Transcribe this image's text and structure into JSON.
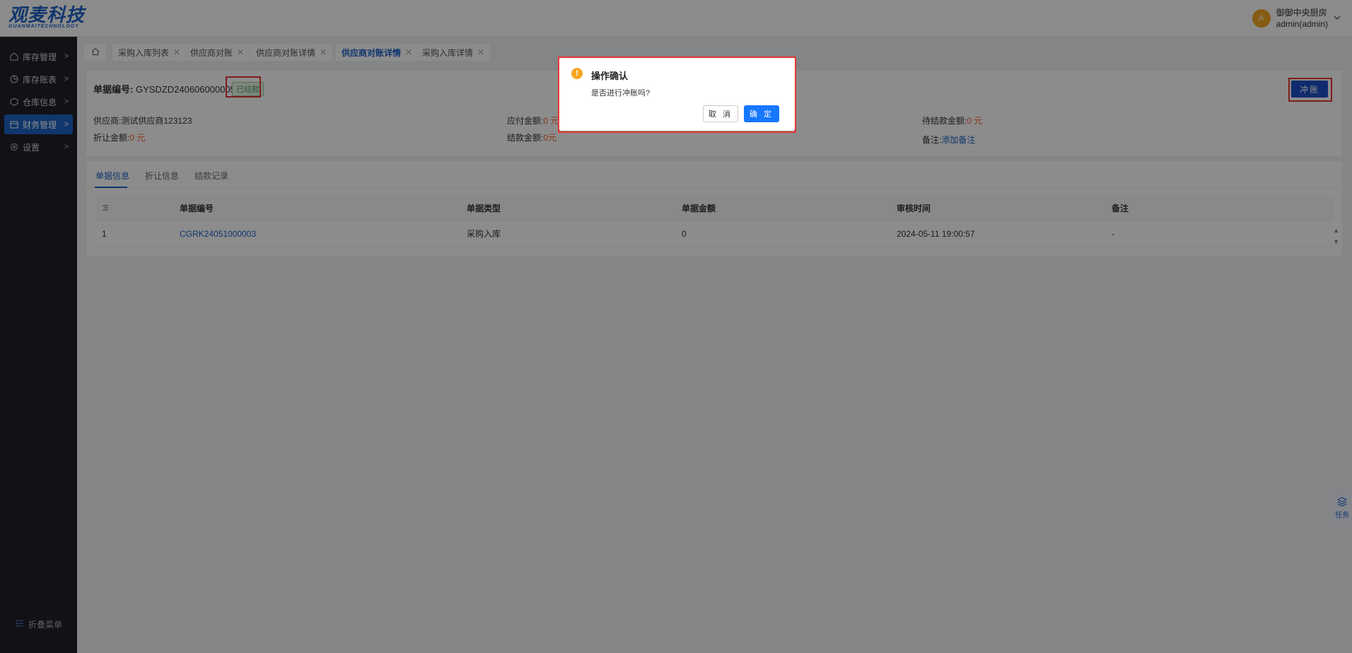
{
  "brand": {
    "name": "观麦科技",
    "sub": "GUANMAITECHNOLOGY",
    "color": "#1e63c7"
  },
  "user": {
    "avatar_letter": "A",
    "name": "御御中央厨房",
    "account": "admin(admin)"
  },
  "sidebar": {
    "items": [
      {
        "label": "库存管理",
        "icon": "warehouse-icon"
      },
      {
        "label": "库存账表",
        "icon": "chart-icon"
      },
      {
        "label": "仓库信息",
        "icon": "box-icon"
      },
      {
        "label": "财务管理",
        "icon": "finance-icon",
        "active": true
      },
      {
        "label": "设置",
        "icon": "gear-icon"
      }
    ],
    "collapse_label": "折叠菜单"
  },
  "tabs": [
    {
      "label": "采购入库列表"
    },
    {
      "label": "供应商对账"
    },
    {
      "label": "供应商对账详情"
    },
    {
      "label": "供应商对账详情",
      "active": true
    },
    {
      "label": "采购入库详情"
    }
  ],
  "summary": {
    "doc_label": "单据编号:",
    "doc_no": "GYSDZD240606000005",
    "status": "已结款",
    "reverse_button": "冲账",
    "supplier_label": "供应商:",
    "supplier": "测试供应商123123",
    "discount_label": "折让金额:",
    "discount": "0 元",
    "payable_label": "应付金额:",
    "payable": "0 元",
    "settled_label": "结款金额:",
    "settled": "0元",
    "pending_label": "待结款金额:",
    "pending": "0 元",
    "remark_label": "备注:",
    "remark_link": "添加备注"
  },
  "detail": {
    "subtabs": [
      "单据信息",
      "折让信息",
      "结款记录"
    ],
    "columns": [
      "单据编号",
      "单据类型",
      "单据金额",
      "审核时间",
      "备注"
    ],
    "rows": [
      {
        "index": "1",
        "doc_no": "CGRK24051000003",
        "type": "采购入库",
        "amount": "0",
        "audit_time": "2024-05-11 19:00:57",
        "remark": "-"
      }
    ]
  },
  "task_widget": {
    "label": "任务"
  },
  "modal": {
    "title": "操作确认",
    "content": "是否进行冲账吗?",
    "cancel": "取 消",
    "ok": "确 定"
  }
}
